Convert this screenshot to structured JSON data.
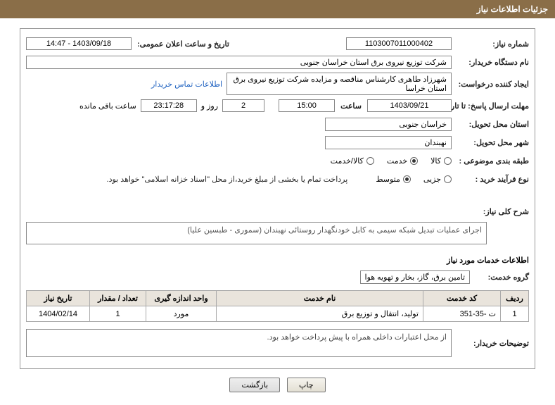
{
  "header": {
    "title": "جزئیات اطلاعات نیاز"
  },
  "fields": {
    "need_number_label": "شماره نیاز:",
    "need_number": "1103007011000402",
    "announce_dt_label": "تاریخ و ساعت اعلان عمومی:",
    "announce_dt": "1403/09/18 - 14:47",
    "buyer_org_label": "نام دستگاه خریدار:",
    "buyer_org": "شرکت توزیع نیروی برق استان خراسان جنوبی",
    "requester_label": "ایجاد کننده درخواست:",
    "requester": "شهرزاد طاهری کارشناس مناقصه و مزایده شرکت توزیع نیروی برق استان خراسا",
    "contact_link": "اطلاعات تماس خریدار",
    "deadline_label": "مهلت ارسال پاسخ: تا تاریخ:",
    "deadline_date": "1403/09/21",
    "hour_label": "ساعت",
    "deadline_hour": "15:00",
    "days_remaining": "2",
    "days_and_label": "روز و",
    "time_remaining": "23:17:28",
    "time_remaining_label": "ساعت باقی مانده",
    "delivery_province_label": "استان محل تحویل:",
    "delivery_province": "خراسان جنوبی",
    "delivery_city_label": "شهر محل تحویل:",
    "delivery_city": "نهبندان",
    "category_label": "طبقه بندی موضوعی :",
    "category_options": {
      "goods": "کالا",
      "service": "خدمت",
      "both": "کالا/خدمت"
    },
    "category_selected": "service",
    "purchase_type_label": "نوع فرآیند خرید :",
    "purchase_options": {
      "minor": "جزیی",
      "medium": "متوسط"
    },
    "purchase_selected": "medium",
    "payment_note": "پرداخت تمام یا بخشی از مبلغ خرید،از محل \"اسناد خزانه اسلامی\" خواهد بود."
  },
  "need_summary": {
    "label": "شرح کلی نیاز:",
    "text": "اجرای عملیات تبدیل شبکه سیمی به کابل خودنگهدار روستائی نهبندان (سموری - طبسین علیا)"
  },
  "services_info": {
    "title": "اطلاعات خدمات مورد نیاز",
    "group_label": "گروه خدمت:",
    "group_value": "تامین برق، گاز، بخار و تهویه هوا"
  },
  "table": {
    "headers": {
      "row": "ردیف",
      "code": "کد خدمت",
      "name": "نام خدمت",
      "unit": "واحد اندازه گیری",
      "qty": "تعداد / مقدار",
      "date": "تاریخ نیاز"
    },
    "rows": [
      {
        "row": "1",
        "code": "ت -35-351",
        "name": "تولید، انتقال و توزیع برق",
        "unit": "مورد",
        "qty": "1",
        "date": "1404/02/14"
      }
    ]
  },
  "buyer_notes": {
    "label": "توضیحات خریدار:",
    "text": "از محل اعتبارات داخلی همراه با پیش پرداخت خواهد بود."
  },
  "buttons": {
    "print": "چاپ",
    "back": "بازگشت"
  }
}
